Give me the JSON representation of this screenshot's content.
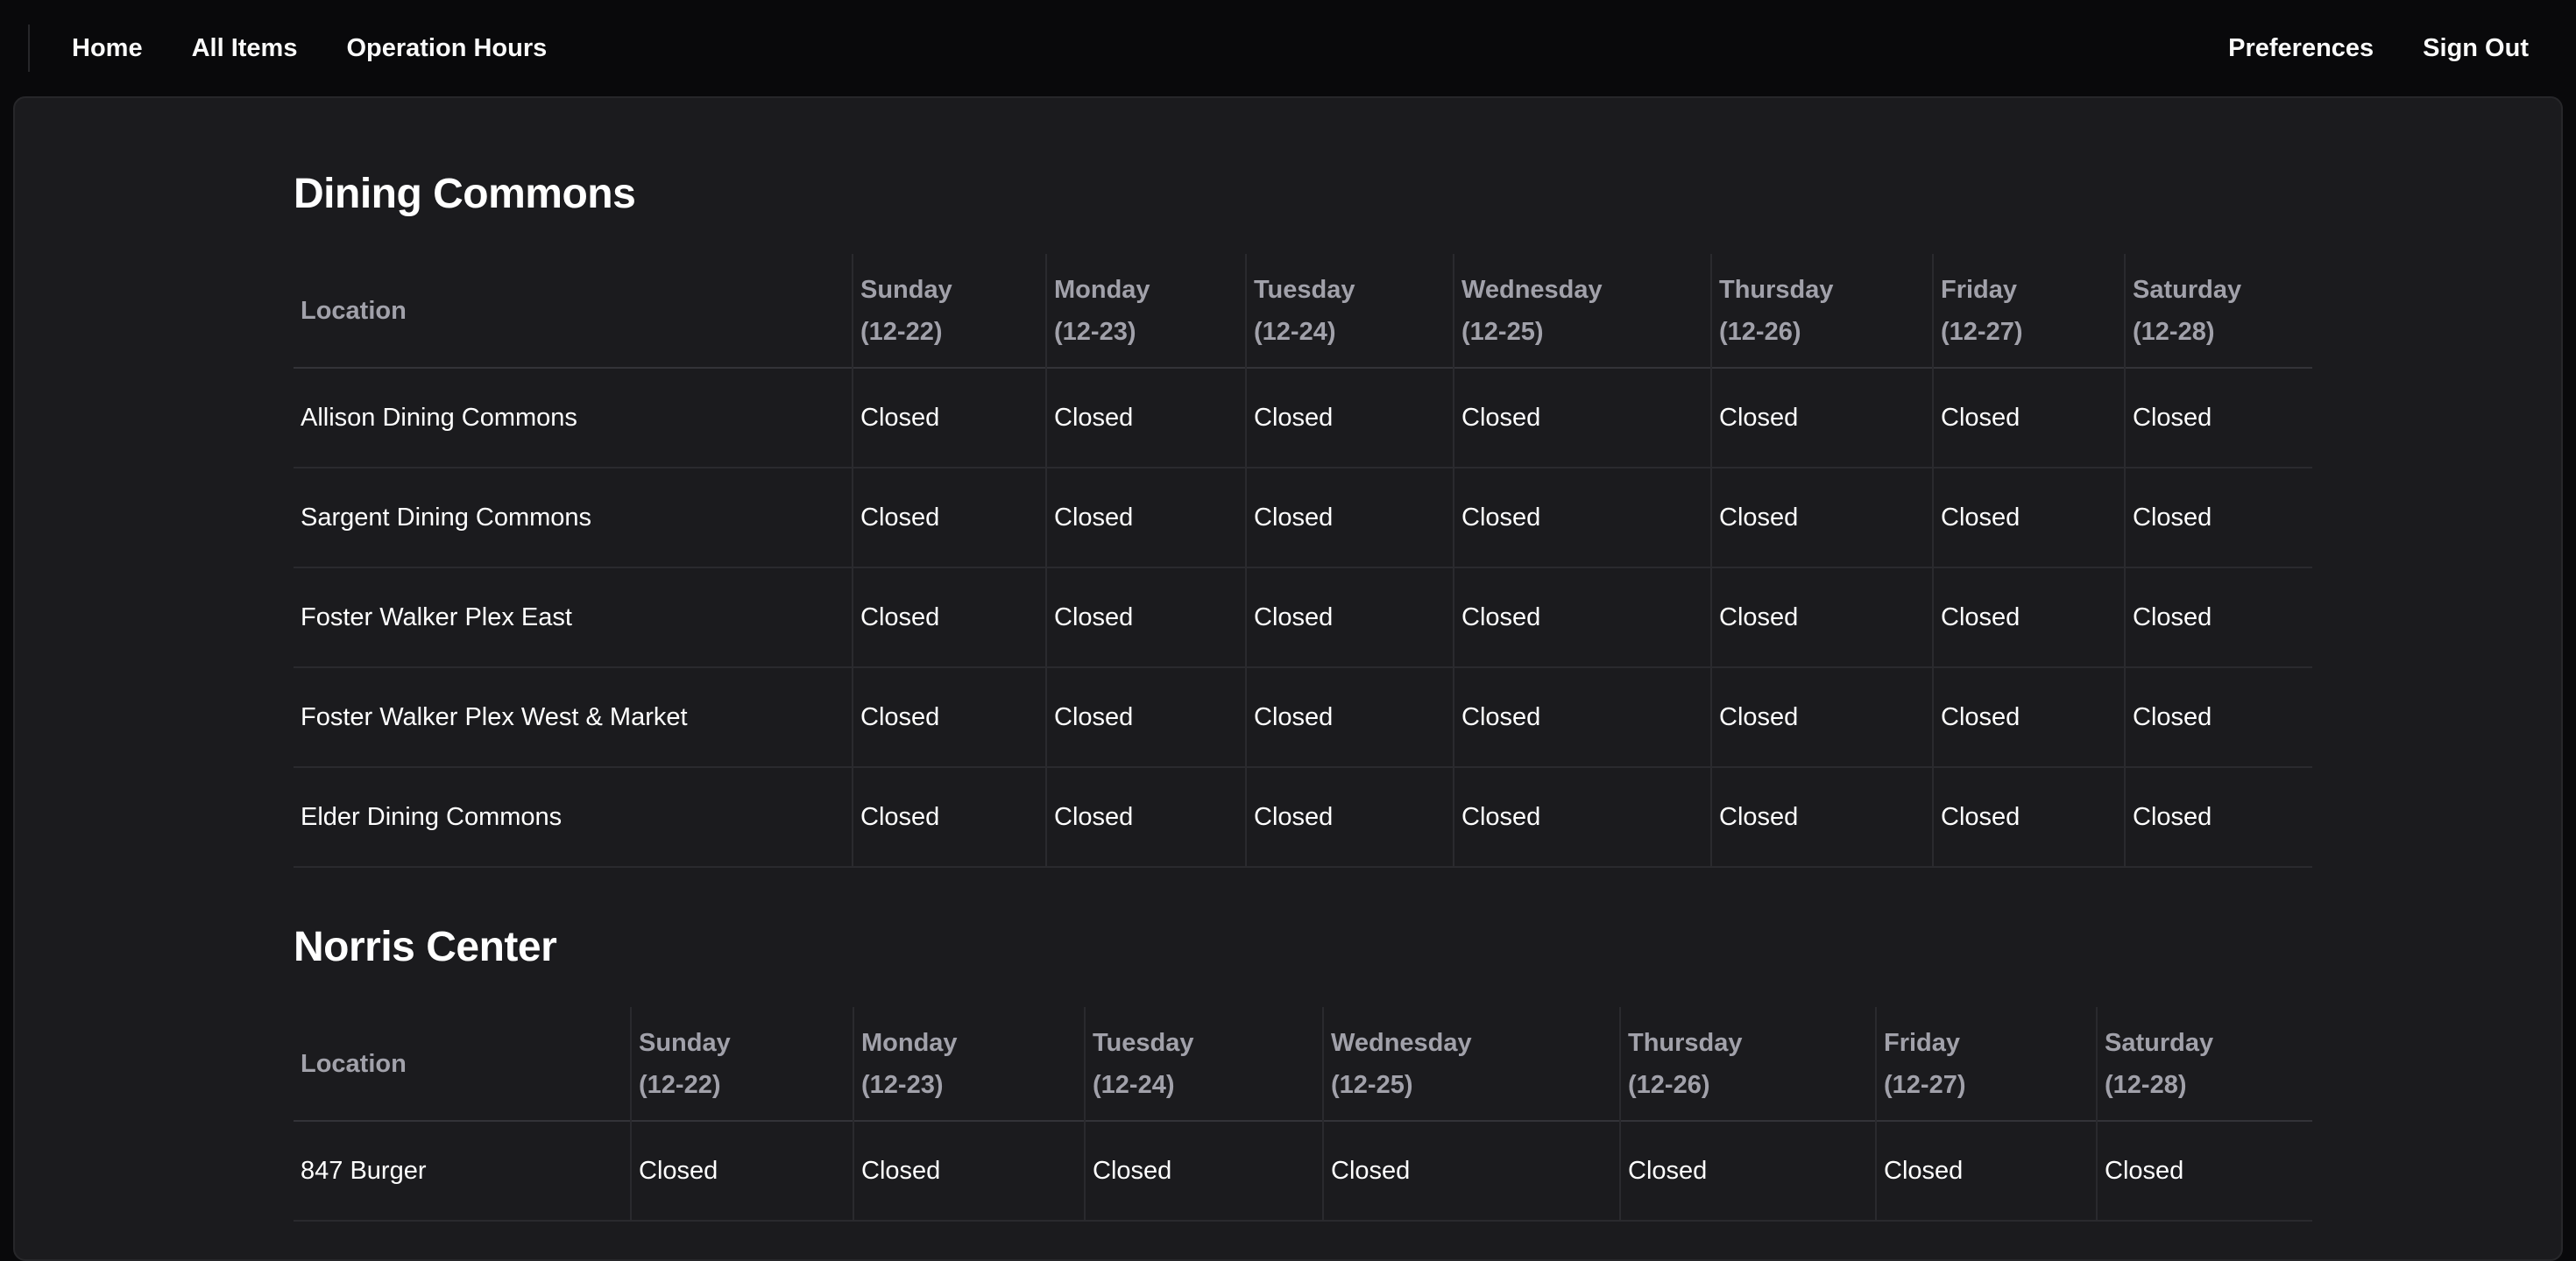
{
  "nav": {
    "left": [
      "Home",
      "All Items",
      "Operation Hours"
    ],
    "right": [
      "Preferences",
      "Sign Out"
    ]
  },
  "columns": {
    "location": "Location",
    "days": [
      {
        "day": "Sunday",
        "date": "(12-22)"
      },
      {
        "day": "Monday",
        "date": "(12-23)"
      },
      {
        "day": "Tuesday",
        "date": "(12-24)"
      },
      {
        "day": "Wednesday",
        "date": "(12-25)"
      },
      {
        "day": "Thursday",
        "date": "(12-26)"
      },
      {
        "day": "Friday",
        "date": "(12-27)"
      },
      {
        "day": "Saturday",
        "date": "(12-28)"
      }
    ]
  },
  "sections": [
    {
      "title": "Dining Commons",
      "rows": [
        {
          "location": "Allison Dining Commons",
          "hours": [
            "Closed",
            "Closed",
            "Closed",
            "Closed",
            "Closed",
            "Closed",
            "Closed"
          ]
        },
        {
          "location": "Sargent Dining Commons",
          "hours": [
            "Closed",
            "Closed",
            "Closed",
            "Closed",
            "Closed",
            "Closed",
            "Closed"
          ]
        },
        {
          "location": "Foster Walker Plex East",
          "hours": [
            "Closed",
            "Closed",
            "Closed",
            "Closed",
            "Closed",
            "Closed",
            "Closed"
          ]
        },
        {
          "location": "Foster Walker Plex West & Market",
          "hours": [
            "Closed",
            "Closed",
            "Closed",
            "Closed",
            "Closed",
            "Closed",
            "Closed"
          ]
        },
        {
          "location": "Elder Dining Commons",
          "hours": [
            "Closed",
            "Closed",
            "Closed",
            "Closed",
            "Closed",
            "Closed",
            "Closed"
          ]
        }
      ]
    },
    {
      "title": "Norris Center",
      "rows": [
        {
          "location": "847 Burger",
          "hours": [
            "Closed",
            "Closed",
            "Closed",
            "Closed",
            "Closed",
            "Closed",
            "Closed"
          ]
        }
      ]
    }
  ]
}
